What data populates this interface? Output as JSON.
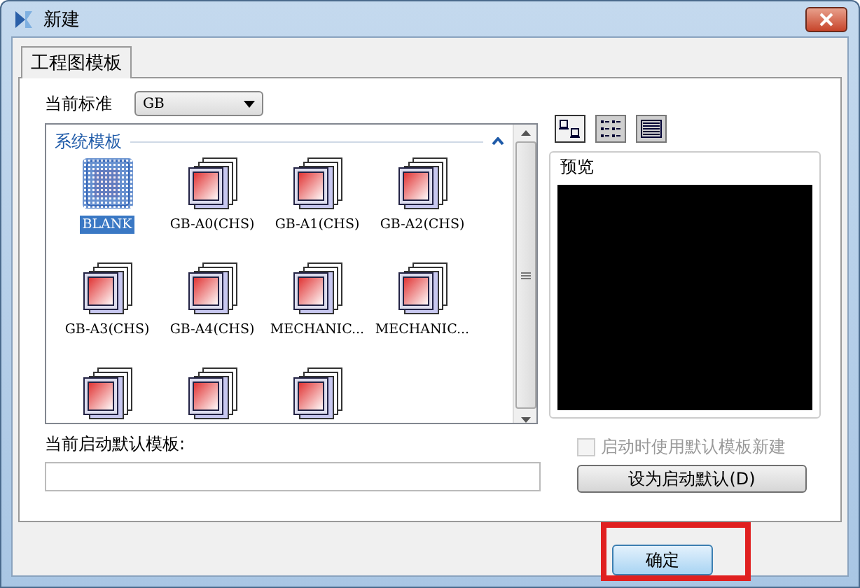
{
  "window": {
    "title": "新建"
  },
  "tabs": [
    {
      "label": "工程图模板",
      "selected": true
    }
  ],
  "standard": {
    "label": "当前标准",
    "value": "GB"
  },
  "template_group": {
    "title": "系统模板",
    "expanded": true
  },
  "templates": [
    {
      "label": "BLANK",
      "kind": "blank",
      "selected": true
    },
    {
      "label": "GB-A0(CHS)",
      "kind": "sheet",
      "selected": false
    },
    {
      "label": "GB-A1(CHS)",
      "kind": "sheet",
      "selected": false
    },
    {
      "label": "GB-A2(CHS)",
      "kind": "sheet",
      "selected": false
    },
    {
      "label": "GB-A3(CHS)",
      "kind": "sheet",
      "selected": false
    },
    {
      "label": "GB-A4(CHS)",
      "kind": "sheet",
      "selected": false
    },
    {
      "label": "MECHANIC...",
      "kind": "sheet",
      "selected": false
    },
    {
      "label": "MECHANIC...",
      "kind": "sheet",
      "selected": false
    },
    {
      "kind": "sheet",
      "selected": false
    },
    {
      "kind": "sheet",
      "selected": false
    },
    {
      "kind": "sheet",
      "selected": false
    }
  ],
  "view_modes": [
    {
      "kind": "large",
      "selected": true
    },
    {
      "kind": "list",
      "selected": false
    },
    {
      "kind": "details",
      "selected": false
    }
  ],
  "preview": {
    "title": "预览"
  },
  "default_template": {
    "label": "当前启动默认模板:"
  },
  "startup_checkbox": {
    "label": "启动时使用默认模板新建",
    "checked": false,
    "disabled": true
  },
  "set_default_button": {
    "label": "设为启动默认(D)"
  },
  "ok_button": {
    "label": "确定",
    "highlighted": true
  }
}
